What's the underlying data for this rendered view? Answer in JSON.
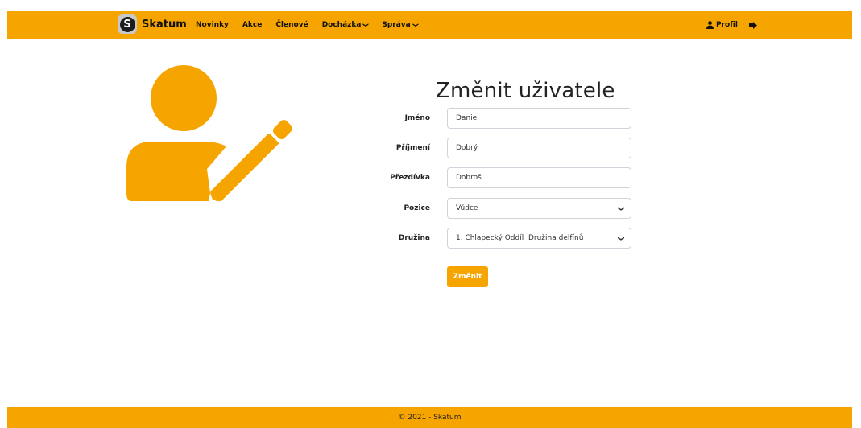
{
  "brand": {
    "logo_letter": "S",
    "name": "Skatum"
  },
  "nav": {
    "links": [
      {
        "label": "Novinky"
      },
      {
        "label": "Akce"
      },
      {
        "label": "Členové"
      },
      {
        "label": "Docházka",
        "dropdown": true
      },
      {
        "label": "Správa",
        "dropdown": true
      }
    ],
    "profile_label": "Profil",
    "profile_icon": "user-icon",
    "logout_icon": "sign-out-icon"
  },
  "hero_icon": "user-edit-icon",
  "form": {
    "title": "Změnit uživatele",
    "fields": [
      {
        "label": "Jméno",
        "value": "Daniel",
        "type": "text"
      },
      {
        "label": "Příjmení",
        "value": "Dobrý",
        "type": "text"
      },
      {
        "label": "Přezdívka",
        "value": "Dobroš",
        "type": "text"
      },
      {
        "label": "Pozice",
        "value": "Vůdce",
        "type": "select"
      },
      {
        "label": "Družina",
        "value": "1. Chlapecký Oddíl  Družina delfínů",
        "type": "select"
      }
    ],
    "submit_label": "Změnit"
  },
  "footer": {
    "text": "© 2021 - Skatum"
  },
  "colors": {
    "accent": "#f5a400"
  }
}
